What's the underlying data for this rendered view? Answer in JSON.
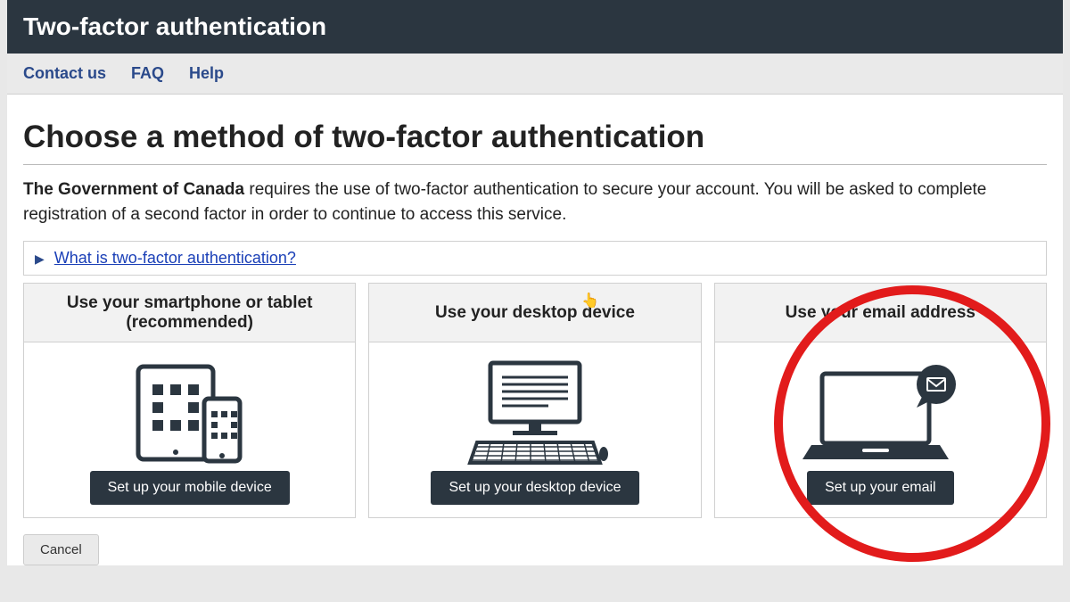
{
  "titlebar": "Two-factor authentication",
  "nav": {
    "contact": "Contact us",
    "faq": "FAQ",
    "help": "Help"
  },
  "heading": "Choose a method of two-factor authentication",
  "intro_strong": "The Government of Canada",
  "intro_rest": " requires the use of two-factor authentication to secure your account. You will be asked to complete registration of a second factor in order to continue to access this service.",
  "disclosure_label": "What is two-factor authentication?",
  "cards": {
    "mobile": {
      "title": "Use your smartphone or tablet (recommended)",
      "button": "Set up your mobile device"
    },
    "desktop": {
      "title": "Use your desktop device",
      "button": "Set up your desktop device"
    },
    "email": {
      "title": "Use your email address",
      "button": "Set up your email"
    }
  },
  "cancel": "Cancel",
  "colors": {
    "dark": "#2b3640",
    "link": "#1a3fb7",
    "highlight": "#e21b1b"
  }
}
